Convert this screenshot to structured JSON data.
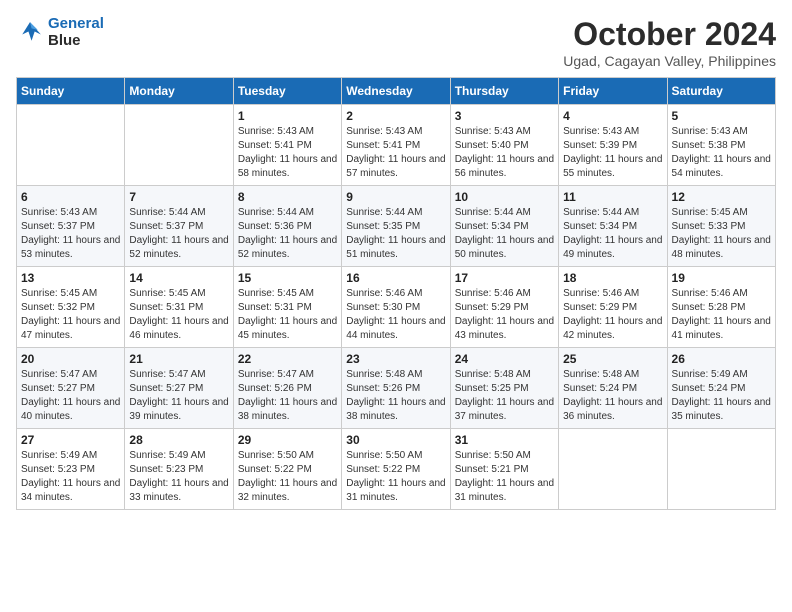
{
  "logo": {
    "line1": "General",
    "line2": "Blue"
  },
  "title": "October 2024",
  "location": "Ugad, Cagayan Valley, Philippines",
  "weekdays": [
    "Sunday",
    "Monday",
    "Tuesday",
    "Wednesday",
    "Thursday",
    "Friday",
    "Saturday"
  ],
  "weeks": [
    [
      {
        "day": "",
        "info": ""
      },
      {
        "day": "",
        "info": ""
      },
      {
        "day": "1",
        "info": "Sunrise: 5:43 AM\nSunset: 5:41 PM\nDaylight: 11 hours and 58 minutes."
      },
      {
        "day": "2",
        "info": "Sunrise: 5:43 AM\nSunset: 5:41 PM\nDaylight: 11 hours and 57 minutes."
      },
      {
        "day": "3",
        "info": "Sunrise: 5:43 AM\nSunset: 5:40 PM\nDaylight: 11 hours and 56 minutes."
      },
      {
        "day": "4",
        "info": "Sunrise: 5:43 AM\nSunset: 5:39 PM\nDaylight: 11 hours and 55 minutes."
      },
      {
        "day": "5",
        "info": "Sunrise: 5:43 AM\nSunset: 5:38 PM\nDaylight: 11 hours and 54 minutes."
      }
    ],
    [
      {
        "day": "6",
        "info": "Sunrise: 5:43 AM\nSunset: 5:37 PM\nDaylight: 11 hours and 53 minutes."
      },
      {
        "day": "7",
        "info": "Sunrise: 5:44 AM\nSunset: 5:37 PM\nDaylight: 11 hours and 52 minutes."
      },
      {
        "day": "8",
        "info": "Sunrise: 5:44 AM\nSunset: 5:36 PM\nDaylight: 11 hours and 52 minutes."
      },
      {
        "day": "9",
        "info": "Sunrise: 5:44 AM\nSunset: 5:35 PM\nDaylight: 11 hours and 51 minutes."
      },
      {
        "day": "10",
        "info": "Sunrise: 5:44 AM\nSunset: 5:34 PM\nDaylight: 11 hours and 50 minutes."
      },
      {
        "day": "11",
        "info": "Sunrise: 5:44 AM\nSunset: 5:34 PM\nDaylight: 11 hours and 49 minutes."
      },
      {
        "day": "12",
        "info": "Sunrise: 5:45 AM\nSunset: 5:33 PM\nDaylight: 11 hours and 48 minutes."
      }
    ],
    [
      {
        "day": "13",
        "info": "Sunrise: 5:45 AM\nSunset: 5:32 PM\nDaylight: 11 hours and 47 minutes."
      },
      {
        "day": "14",
        "info": "Sunrise: 5:45 AM\nSunset: 5:31 PM\nDaylight: 11 hours and 46 minutes."
      },
      {
        "day": "15",
        "info": "Sunrise: 5:45 AM\nSunset: 5:31 PM\nDaylight: 11 hours and 45 minutes."
      },
      {
        "day": "16",
        "info": "Sunrise: 5:46 AM\nSunset: 5:30 PM\nDaylight: 11 hours and 44 minutes."
      },
      {
        "day": "17",
        "info": "Sunrise: 5:46 AM\nSunset: 5:29 PM\nDaylight: 11 hours and 43 minutes."
      },
      {
        "day": "18",
        "info": "Sunrise: 5:46 AM\nSunset: 5:29 PM\nDaylight: 11 hours and 42 minutes."
      },
      {
        "day": "19",
        "info": "Sunrise: 5:46 AM\nSunset: 5:28 PM\nDaylight: 11 hours and 41 minutes."
      }
    ],
    [
      {
        "day": "20",
        "info": "Sunrise: 5:47 AM\nSunset: 5:27 PM\nDaylight: 11 hours and 40 minutes."
      },
      {
        "day": "21",
        "info": "Sunrise: 5:47 AM\nSunset: 5:27 PM\nDaylight: 11 hours and 39 minutes."
      },
      {
        "day": "22",
        "info": "Sunrise: 5:47 AM\nSunset: 5:26 PM\nDaylight: 11 hours and 38 minutes."
      },
      {
        "day": "23",
        "info": "Sunrise: 5:48 AM\nSunset: 5:26 PM\nDaylight: 11 hours and 38 minutes."
      },
      {
        "day": "24",
        "info": "Sunrise: 5:48 AM\nSunset: 5:25 PM\nDaylight: 11 hours and 37 minutes."
      },
      {
        "day": "25",
        "info": "Sunrise: 5:48 AM\nSunset: 5:24 PM\nDaylight: 11 hours and 36 minutes."
      },
      {
        "day": "26",
        "info": "Sunrise: 5:49 AM\nSunset: 5:24 PM\nDaylight: 11 hours and 35 minutes."
      }
    ],
    [
      {
        "day": "27",
        "info": "Sunrise: 5:49 AM\nSunset: 5:23 PM\nDaylight: 11 hours and 34 minutes."
      },
      {
        "day": "28",
        "info": "Sunrise: 5:49 AM\nSunset: 5:23 PM\nDaylight: 11 hours and 33 minutes."
      },
      {
        "day": "29",
        "info": "Sunrise: 5:50 AM\nSunset: 5:22 PM\nDaylight: 11 hours and 32 minutes."
      },
      {
        "day": "30",
        "info": "Sunrise: 5:50 AM\nSunset: 5:22 PM\nDaylight: 11 hours and 31 minutes."
      },
      {
        "day": "31",
        "info": "Sunrise: 5:50 AM\nSunset: 5:21 PM\nDaylight: 11 hours and 31 minutes."
      },
      {
        "day": "",
        "info": ""
      },
      {
        "day": "",
        "info": ""
      }
    ]
  ]
}
